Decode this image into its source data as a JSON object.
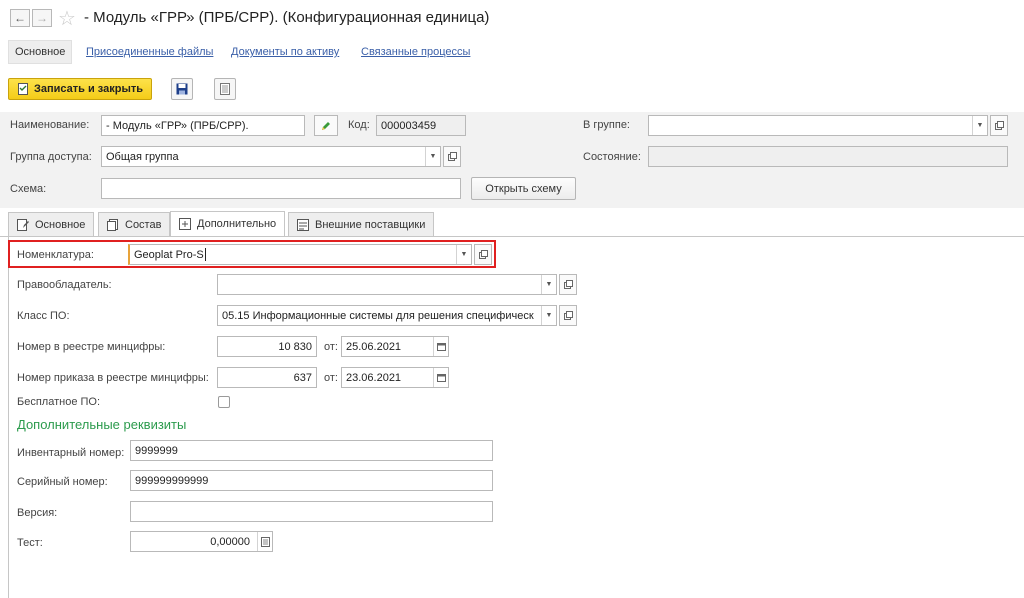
{
  "window": {
    "title": "- Модуль «ГРР» (ПРБ/СРР). (Конфигурационная единица)"
  },
  "sections": {
    "main": "Основное",
    "files": "Присоединенные файлы",
    "docs": "Документы по активу",
    "processes": "Связанные процессы"
  },
  "toolbar": {
    "save_close_label": "Записать и закрыть"
  },
  "header": {
    "name_label": "Наименование:",
    "name_value": "- Модуль «ГРР» (ПРБ/СРР).",
    "code_label": "Код:",
    "code_value": "000003459",
    "group_label": "В группе:",
    "group_value": "",
    "access_label": "Группа доступа:",
    "access_value": "Общая группа",
    "state_label": "Состояние:",
    "state_value": "",
    "scheme_label": "Схема:",
    "scheme_value": "",
    "open_scheme_label": "Открыть схему"
  },
  "tabs": [
    {
      "label": "Основное"
    },
    {
      "label": "Состав"
    },
    {
      "label": "Дополнительно"
    },
    {
      "label": "Внешние поставщики"
    }
  ],
  "form": {
    "nomenclature_label": "Номенклатура:",
    "nomenclature_value": "Geoplat Pro-S",
    "owner_label": "Правообладатель:",
    "owner_value": "",
    "class_label": "Класс ПО:",
    "class_value": "05.15 Информационные системы для решения специфическ",
    "registry_no_label": "Номер в реестре минцифры:",
    "registry_no_value": "10 830",
    "registry_date_label": "от:",
    "registry_date_value": "25.06.2021",
    "order_no_label": "Номер приказа в реестре минцифры:",
    "order_no_value": "637",
    "order_date_label": "от:",
    "order_date_value": "23.06.2021",
    "free_label": "Бесплатное ПО:",
    "free_checked": false
  },
  "extra": {
    "heading": "Дополнительные реквизиты",
    "inventory_label": "Инвентарный номер:",
    "inventory_value": "9999999",
    "serial_label": "Серийный номер:",
    "serial_value": "999999999999",
    "version_label": "Версия:",
    "version_value": "",
    "test_label": "Тест:",
    "test_value": "0,00000"
  },
  "colors": {
    "accent_yellow": "#f4cc18",
    "highlight_red": "#e02020",
    "section_green": "#2c9b4d",
    "link_blue": "#3a5fa8"
  }
}
